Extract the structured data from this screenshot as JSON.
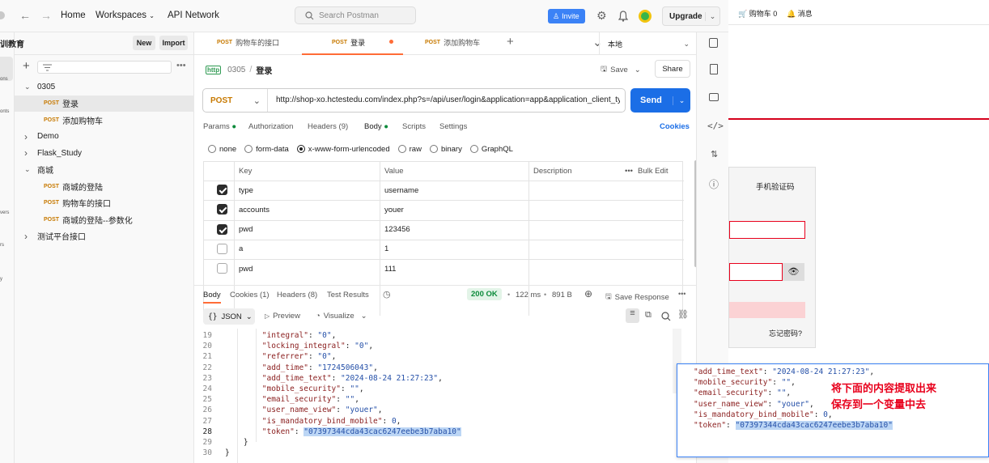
{
  "topbar": {
    "home": "Home",
    "workspaces": "Workspaces",
    "api_network": "API Network",
    "search_placeholder": "Search Postman",
    "invite": "Invite",
    "upgrade": "Upgrade"
  },
  "sidebar": {
    "workspace_name": "训教育",
    "new": "New",
    "import": "Import",
    "rail_labels": [
      "ons",
      "onts",
      "vers",
      "rs",
      "y"
    ],
    "tree": [
      {
        "type": "folder",
        "label": "0305",
        "open": true,
        "indent": 0
      },
      {
        "type": "req",
        "method": "POST",
        "label": "登录",
        "indent": 1,
        "active": true
      },
      {
        "type": "req",
        "method": "POST",
        "label": "添加购物车",
        "indent": 1
      },
      {
        "type": "folder",
        "label": "Demo",
        "open": false,
        "indent": 0
      },
      {
        "type": "folder",
        "label": "Flask_Study",
        "open": false,
        "indent": 0
      },
      {
        "type": "folder",
        "label": "商城",
        "open": true,
        "indent": 0
      },
      {
        "type": "req",
        "method": "POST",
        "label": "商城的登陆",
        "indent": 1
      },
      {
        "type": "req",
        "method": "POST",
        "label": "购物车的接口",
        "indent": 1
      },
      {
        "type": "req",
        "method": "POST",
        "label": "商城的登陆--参数化",
        "indent": 1
      },
      {
        "type": "folder",
        "label": "测试平台接口",
        "open": false,
        "indent": 0
      }
    ]
  },
  "tabs": [
    {
      "method": "POST",
      "label": "购物车的接口"
    },
    {
      "method": "POST",
      "label": "登录",
      "active": true
    },
    {
      "method": "POST",
      "label": "添加购物车"
    }
  ],
  "env": "本地",
  "request": {
    "breadcrumb_parent": "0305",
    "breadcrumb_sep": "/",
    "breadcrumb_current": "登录",
    "save": "Save",
    "share": "Share",
    "method": "POST",
    "url": "http://shop-xo.hctestedu.com/index.php?s=/api/user/login&application=app&application_client_type",
    "send": "Send",
    "subtabs": [
      "Params",
      "Authorization",
      "Headers (9)",
      "Body",
      "Scripts",
      "Settings"
    ],
    "cookies": "Cookies",
    "body_types": [
      "none",
      "form-data",
      "x-www-form-urlencoded",
      "raw",
      "binary",
      "GraphQL"
    ],
    "columns": [
      "Key",
      "Value",
      "Description"
    ],
    "bulk_edit": "Bulk Edit",
    "rows": [
      {
        "checked": true,
        "key": "type",
        "value": "username"
      },
      {
        "checked": true,
        "key": "accounts",
        "value": "youer"
      },
      {
        "checked": true,
        "key": "pwd",
        "value": "123456"
      },
      {
        "checked": false,
        "key": "a",
        "value": "1"
      },
      {
        "checked": false,
        "key": "pwd",
        "value": "111"
      }
    ]
  },
  "response": {
    "tabs": [
      "Body",
      "Cookies (1)",
      "Headers (8)",
      "Test Results"
    ],
    "status": "200 OK",
    "time": "122 ms",
    "size": "891 B",
    "save_response": "Save Response",
    "format": "JSON",
    "preview": "Preview",
    "visualize": "Visualize",
    "lines": [
      {
        "n": "19",
        "indent": "        ",
        "key": "\"integral\"",
        "val": "\"0\"",
        "end": ","
      },
      {
        "n": "20",
        "indent": "        ",
        "key": "\"locking_integral\"",
        "val": "\"0\"",
        "end": ","
      },
      {
        "n": "21",
        "indent": "        ",
        "key": "\"referrer\"",
        "val": "\"0\"",
        "end": ","
      },
      {
        "n": "22",
        "indent": "        ",
        "key": "\"add_time\"",
        "val": "\"1724506043\"",
        "end": ","
      },
      {
        "n": "23",
        "indent": "        ",
        "key": "\"add_time_text\"",
        "val": "\"2024-08-24 21:27:23\"",
        "end": ","
      },
      {
        "n": "24",
        "indent": "        ",
        "key": "\"mobile_security\"",
        "val": "\"\"",
        "end": ","
      },
      {
        "n": "25",
        "indent": "        ",
        "key": "\"email_security\"",
        "val": "\"\"",
        "end": ","
      },
      {
        "n": "26",
        "indent": "        ",
        "key": "\"user_name_view\"",
        "val": "\"youer\"",
        "end": ","
      },
      {
        "n": "27",
        "indent": "        ",
        "key": "\"is_mandatory_bind_mobile\"",
        "val": "0",
        "end": ","
      },
      {
        "n": "28",
        "indent": "        ",
        "key": "\"token\"",
        "val": "\"07397344cda43cac6247eebe3b7aba10\"",
        "end": ""
      },
      {
        "n": "29",
        "indent": "    ",
        "plain": "}"
      },
      {
        "n": "30",
        "indent": "",
        "plain": "}"
      }
    ]
  },
  "website": {
    "cart": "购物车 0",
    "messages": "消息",
    "sms_login": "手机验证码",
    "forgot": "忘记密码?"
  },
  "overlay": {
    "note_line1": "将下面的内容提取出来",
    "note_line2": "保存到一个变量中去",
    "lines": [
      {
        "key": "\"add_time_text\"",
        "val": "\"2024-08-24 21:27:23\"",
        "end": ","
      },
      {
        "key": "\"mobile_security\"",
        "val": "\"\"",
        "end": ","
      },
      {
        "key": "\"email_security\"",
        "val": "\"\"",
        "end": ","
      },
      {
        "key": "\"user_name_view\"",
        "val": "\"youer\"",
        "end": ","
      },
      {
        "key": "\"is_mandatory_bind_mobile\"",
        "val": "0",
        "end": ","
      },
      {
        "key": "\"token\"",
        "val": "\"07397344cda43cac6247eebe3b7aba10\"",
        "end": ""
      }
    ]
  },
  "colors": {
    "accent": "#ff6c37",
    "send": "#1b6ee6",
    "invite": "#3b82f6",
    "status_ok": "#0b8a3a",
    "overlay_note": "#e8001c"
  }
}
